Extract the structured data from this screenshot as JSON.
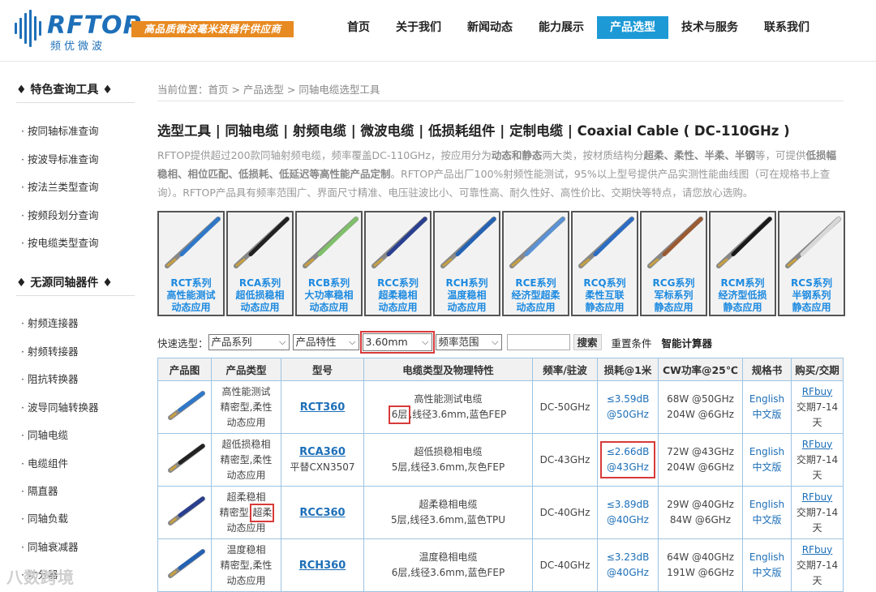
{
  "brand": {
    "logo_text": "RFTOP",
    "logo_sub": "频优微波",
    "slogan": "高品质微波毫米波器件供应商"
  },
  "nav": [
    {
      "label": "首页"
    },
    {
      "label": "关于我们"
    },
    {
      "label": "新闻动态"
    },
    {
      "label": "能力展示"
    },
    {
      "label": "产品选型",
      "active": true
    },
    {
      "label": "技术与服务"
    },
    {
      "label": "联系我们"
    }
  ],
  "sidebar": {
    "section1_title": "♦ 特色查询工具 ♦",
    "section1_items": [
      "· 按同轴标准查询",
      "· 按波导标准查询",
      "· 按法兰类型查询",
      "· 按频段划分查询",
      "· 按电缆类型查询"
    ],
    "section2_title": "♦ 无源同轴器件 ♦",
    "section2_items": [
      "· 射频连接器",
      "· 射频转接器",
      "· 阻抗转换器",
      "· 波导同轴转换器",
      "· 同轴电缆",
      "· 电缆组件",
      "· 隔直器",
      "· 同轴负载",
      "· 同轴衰减器",
      "· 功分器"
    ]
  },
  "breadcrumb": "当前位置：首页 > 产品选型 > 同轴电缆选型工具",
  "page_title": "选型工具 | 同轴电缆 | 射频电缆 | 微波电缆 | 低损耗组件 | 定制电缆 | Coaxial Cable ( DC-110GHz )",
  "intro": {
    "p1": "RFTOP提供超过200款同轴射频电缆，频率覆盖DC-110GHz，按应用分为",
    "b1": "动态和静态",
    "p2": "两大类，按材质结构分",
    "b2": "超柔、柔性、半柔、半钢",
    "p3": "等，可提供",
    "b3": "低损幅稳相、相位匹配、低损耗、低延迟等高性能产品定制",
    "p4": "。RFTOP产品出厂100%射频性能测试，95%以上型号提供产品实测性能曲线图（可在规格书上查询）。RFTOP产品具有频率范围广、界面尺寸精准、电压驻波比小、可靠性高、耐久性好、高性价比、交期快等特点，请您放心选购。"
  },
  "cards": [
    {
      "l1": "RCT系列",
      "l2": "高性能测试",
      "l3": "动态应用",
      "color": "#2f78c8"
    },
    {
      "l1": "RCA系列",
      "l2": "超低损稳相",
      "l3": "动态应用",
      "color": "#222222"
    },
    {
      "l1": "RCB系列",
      "l2": "大功率稳相",
      "l3": "动态应用",
      "color": "#7fbf6a"
    },
    {
      "l1": "RCC系列",
      "l2": "超柔稳相",
      "l3": "动态应用",
      "color": "#2a3f8f"
    },
    {
      "l1": "RCH系列",
      "l2": "温度稳相",
      "l3": "动态应用",
      "color": "#2462b4"
    },
    {
      "l1": "RCE系列",
      "l2": "经济型超柔",
      "l3": "动态应用",
      "color": "#5a92d4"
    },
    {
      "l1": "RCQ系列",
      "l2": "柔性互联",
      "l3": "静态应用",
      "color": "#2c6cc2"
    },
    {
      "l1": "RCG系列",
      "l2": "军标系列",
      "l3": "静态应用",
      "color": "#9a5a32"
    },
    {
      "l1": "RCM系列",
      "l2": "经济型低损",
      "l3": "静态应用",
      "color": "#1a1a1a"
    },
    {
      "l1": "RCS系列",
      "l2": "半钢系列",
      "l3": "静态应用",
      "color": "#d8d8d8"
    }
  ],
  "filter": {
    "label": "快速选型：",
    "series": "产品系列",
    "feature": "产品特性",
    "diameter": "3.60mm",
    "freq": "频率范围",
    "search": "搜索",
    "reset": "重置条件",
    "calc": "智能计算器"
  },
  "table": {
    "headers": [
      "产品图",
      "产品类型",
      "型号",
      "电缆类型及物理特性",
      "频率/驻波",
      "损耗@1米",
      "CW功率@25℃",
      "规格书",
      "购买/交期"
    ],
    "rows": [
      {
        "type1": "高性能测试",
        "type2": "精密型,柔性",
        "type3": "动态应用",
        "model": "RCT360",
        "model2": "",
        "desc1": "高性能测试电缆",
        "desc_layers": "6层",
        "desc2": ",线径3.6mm,蓝色FEP",
        "freq": "DC-50GHz",
        "loss1": "≤3.59dB",
        "loss2": "@50GHz",
        "pw1": "68W @50GHz",
        "pw2": "204W @6GHz",
        "en": "English",
        "cn": "中文版",
        "buy": "RFbuy",
        "lead1": "交期7-14",
        "lead2": "天",
        "color": "#2f78c8"
      },
      {
        "type1": "超低损稳相",
        "type2": "精密型,柔性",
        "type3": "动态应用",
        "model": "RCA360",
        "model2": "平替CXN3507",
        "desc1": "超低损稳相电缆",
        "desc_layers": "",
        "desc2": "5层,线径3.6mm,灰色FEP",
        "freq": "DC-43GHz",
        "loss1": "≤2.66dB",
        "loss2": "@43GHz",
        "pw1": "72W @43GHz",
        "pw2": "204W @6GHz",
        "en": "English",
        "cn": "中文版",
        "buy": "RFbuy",
        "lead1": "交期7-14",
        "lead2": "天",
        "color": "#222222"
      },
      {
        "type1": "超柔稳相",
        "type2": "精密型,",
        "type2b": "超柔",
        "type3": "动态应用",
        "model": "RCC360",
        "model2": "",
        "desc1": "超柔稳相电缆",
        "desc_layers": "",
        "desc2": "5层,线径3.6mm,蓝色TPU",
        "freq": "DC-40GHz",
        "loss1": "≤3.89dB",
        "loss2": "@40GHz",
        "pw1": "29W @40GHz",
        "pw2": "84W @6GHz",
        "en": "English",
        "cn": "中文版",
        "buy": "RFbuy",
        "lead1": "交期7-14",
        "lead2": "天",
        "color": "#2a3f8f"
      },
      {
        "type1": "温度稳相",
        "type2": "精密型,柔性",
        "type3": "动态应用",
        "model": "RCH360",
        "model2": "",
        "desc1": "温度稳相电缆",
        "desc_layers": "",
        "desc2": "6层,线径3.6mm,蓝色FEP",
        "freq": "DC-40GHz",
        "loss1": "≤3.23dB",
        "loss2": "@40GHz",
        "pw1": "64W @40GHz",
        "pw2": "191W @6GHz",
        "en": "English",
        "cn": "中文版",
        "buy": "RFbuy",
        "lead1": "交期7-14",
        "lead2": "天",
        "color": "#2462b4"
      }
    ]
  },
  "watermark": "八数跨境"
}
